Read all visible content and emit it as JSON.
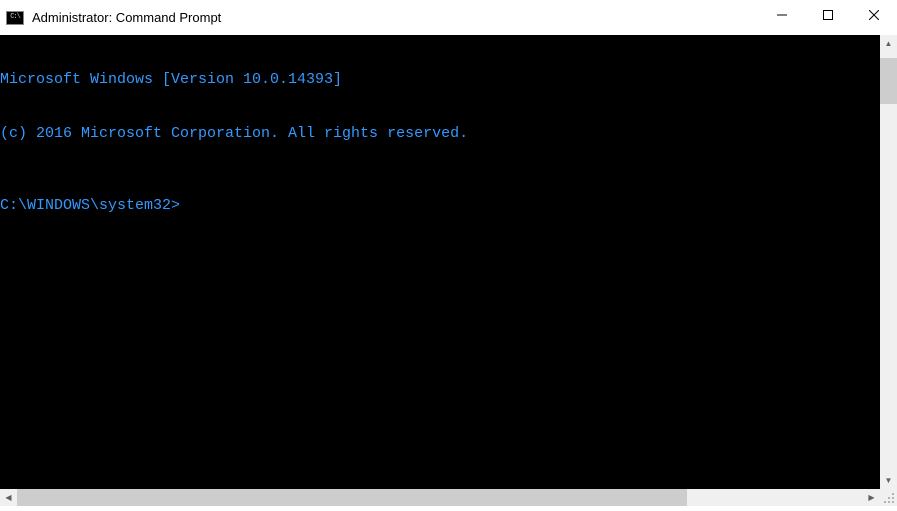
{
  "titlebar": {
    "title": "Administrator: Command Prompt"
  },
  "terminal": {
    "line1": "Microsoft Windows [Version 10.0.14393]",
    "line2": "(c) 2016 Microsoft Corporation. All rights reserved.",
    "prompt": "C:\\WINDOWS\\system32>"
  }
}
